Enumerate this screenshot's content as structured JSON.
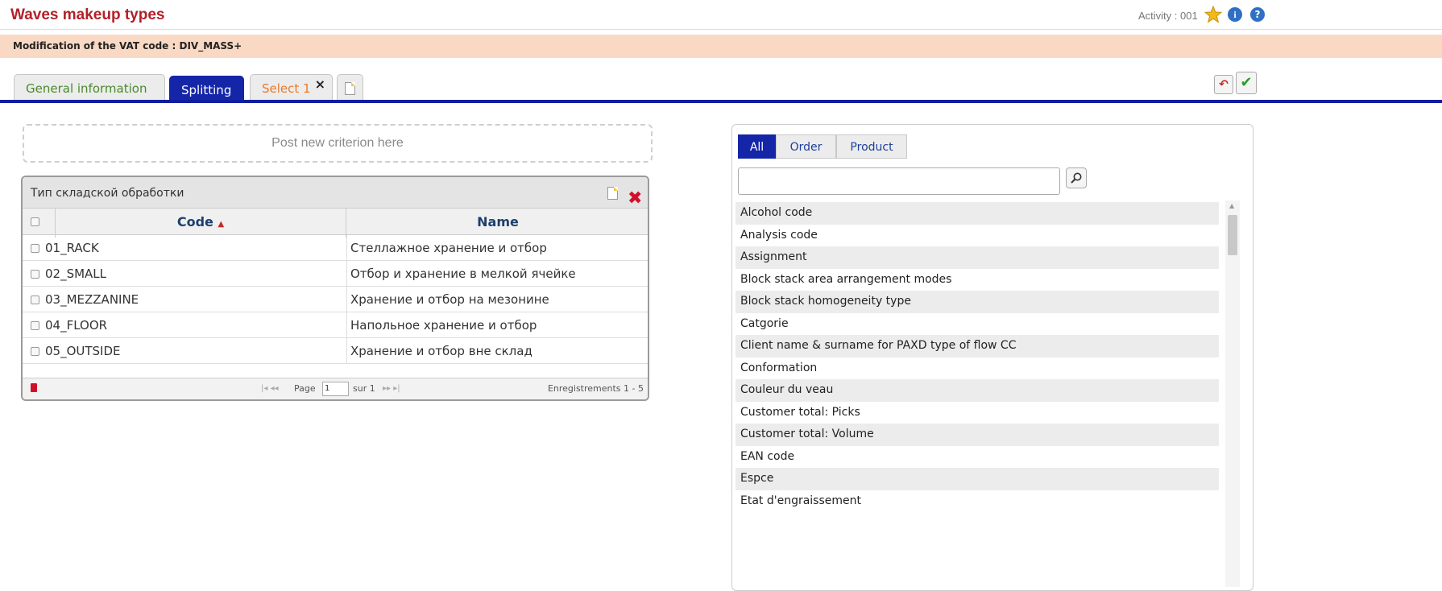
{
  "header": {
    "title": "Waves makeup types",
    "activity": "Activity : 001",
    "icons": [
      "star-icon",
      "info-icon",
      "help-icon"
    ]
  },
  "modbar": {
    "text": "Modification of the VAT code : DIV_MASS+"
  },
  "tabs": [
    {
      "label": "General information",
      "active": false
    },
    {
      "label": "Splitting",
      "active": true
    },
    {
      "label": "Select 1",
      "active": false,
      "closable": true
    }
  ],
  "criterion": {
    "placeholder": "Post new criterion here"
  },
  "grid": {
    "title": "Тип складской обработки",
    "columns": {
      "code": "Code",
      "name": "Name"
    },
    "rows": [
      {
        "code": "01_RACK",
        "name": "Стеллажное хранение и отбор"
      },
      {
        "code": "02_SMALL",
        "name": "Отбор и хранение в мелкой ячейке"
      },
      {
        "code": "03_MEZZANINE",
        "name": "Хранение и отбор на мезонине"
      },
      {
        "code": "04_FLOOR",
        "name": "Напольное хранение и отбор"
      },
      {
        "code": "05_OUTSIDE",
        "name": "Хранение и отбор вне склад"
      }
    ],
    "pager": {
      "page_label": "Page",
      "page_value": "1",
      "sur_label": "sur 1",
      "records": "Enregistrements 1 - 5"
    }
  },
  "filter": {
    "tabs": [
      "All",
      "Order",
      "Product"
    ],
    "active_tab": "All",
    "search_value": ""
  },
  "attributes": [
    "Alcohol code",
    "Analysis code",
    "Assignment",
    "Block stack area arrangement modes",
    "Block stack homogeneity type",
    "Catgorie",
    "Client name & surname for PAXD type of flow CC",
    "Conformation",
    "Couleur du veau",
    "Customer total: Picks",
    "Customer total: Volume",
    "EAN code",
    "Espce",
    "Etat d'engraissement"
  ],
  "colors": {
    "title": "#b3202a",
    "tab_active": "#1525a8",
    "modbar_bg": "#f9d9c3"
  }
}
